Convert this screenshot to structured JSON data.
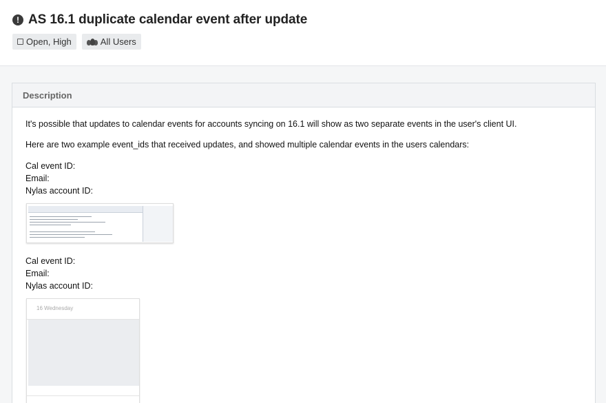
{
  "issue": {
    "title": "AS 16.1 duplicate calendar event after update",
    "status_badge": "Open, High",
    "audience_badge": "All Users",
    "icons": {
      "title": "alert-circle-icon",
      "status": "square-icon",
      "audience": "users-icon"
    }
  },
  "description": {
    "heading": "Description",
    "paragraphs": [
      "It's possible that updates to calendar events for accounts syncing on 16.1 will show as two separate events in the user's client UI.",
      "Here are two example event_ids that received updates, and showed multiple calendar events in the users calendars:"
    ],
    "examples": [
      {
        "cal_event_label": "Cal event ID:",
        "email_label": "Email:",
        "account_label": "Nylas account ID:"
      },
      {
        "cal_event_label": "Cal event ID:",
        "email_label": "Email:",
        "account_label": "Nylas account ID:"
      }
    ],
    "calendar_thumb_label": "16 Wednesday"
  },
  "colors": {
    "header_bg": "#ffffff",
    "page_bg": "#f5f6f7",
    "badge_bg": "#e9ebed",
    "panel_header_bg": "#f3f4f6"
  }
}
